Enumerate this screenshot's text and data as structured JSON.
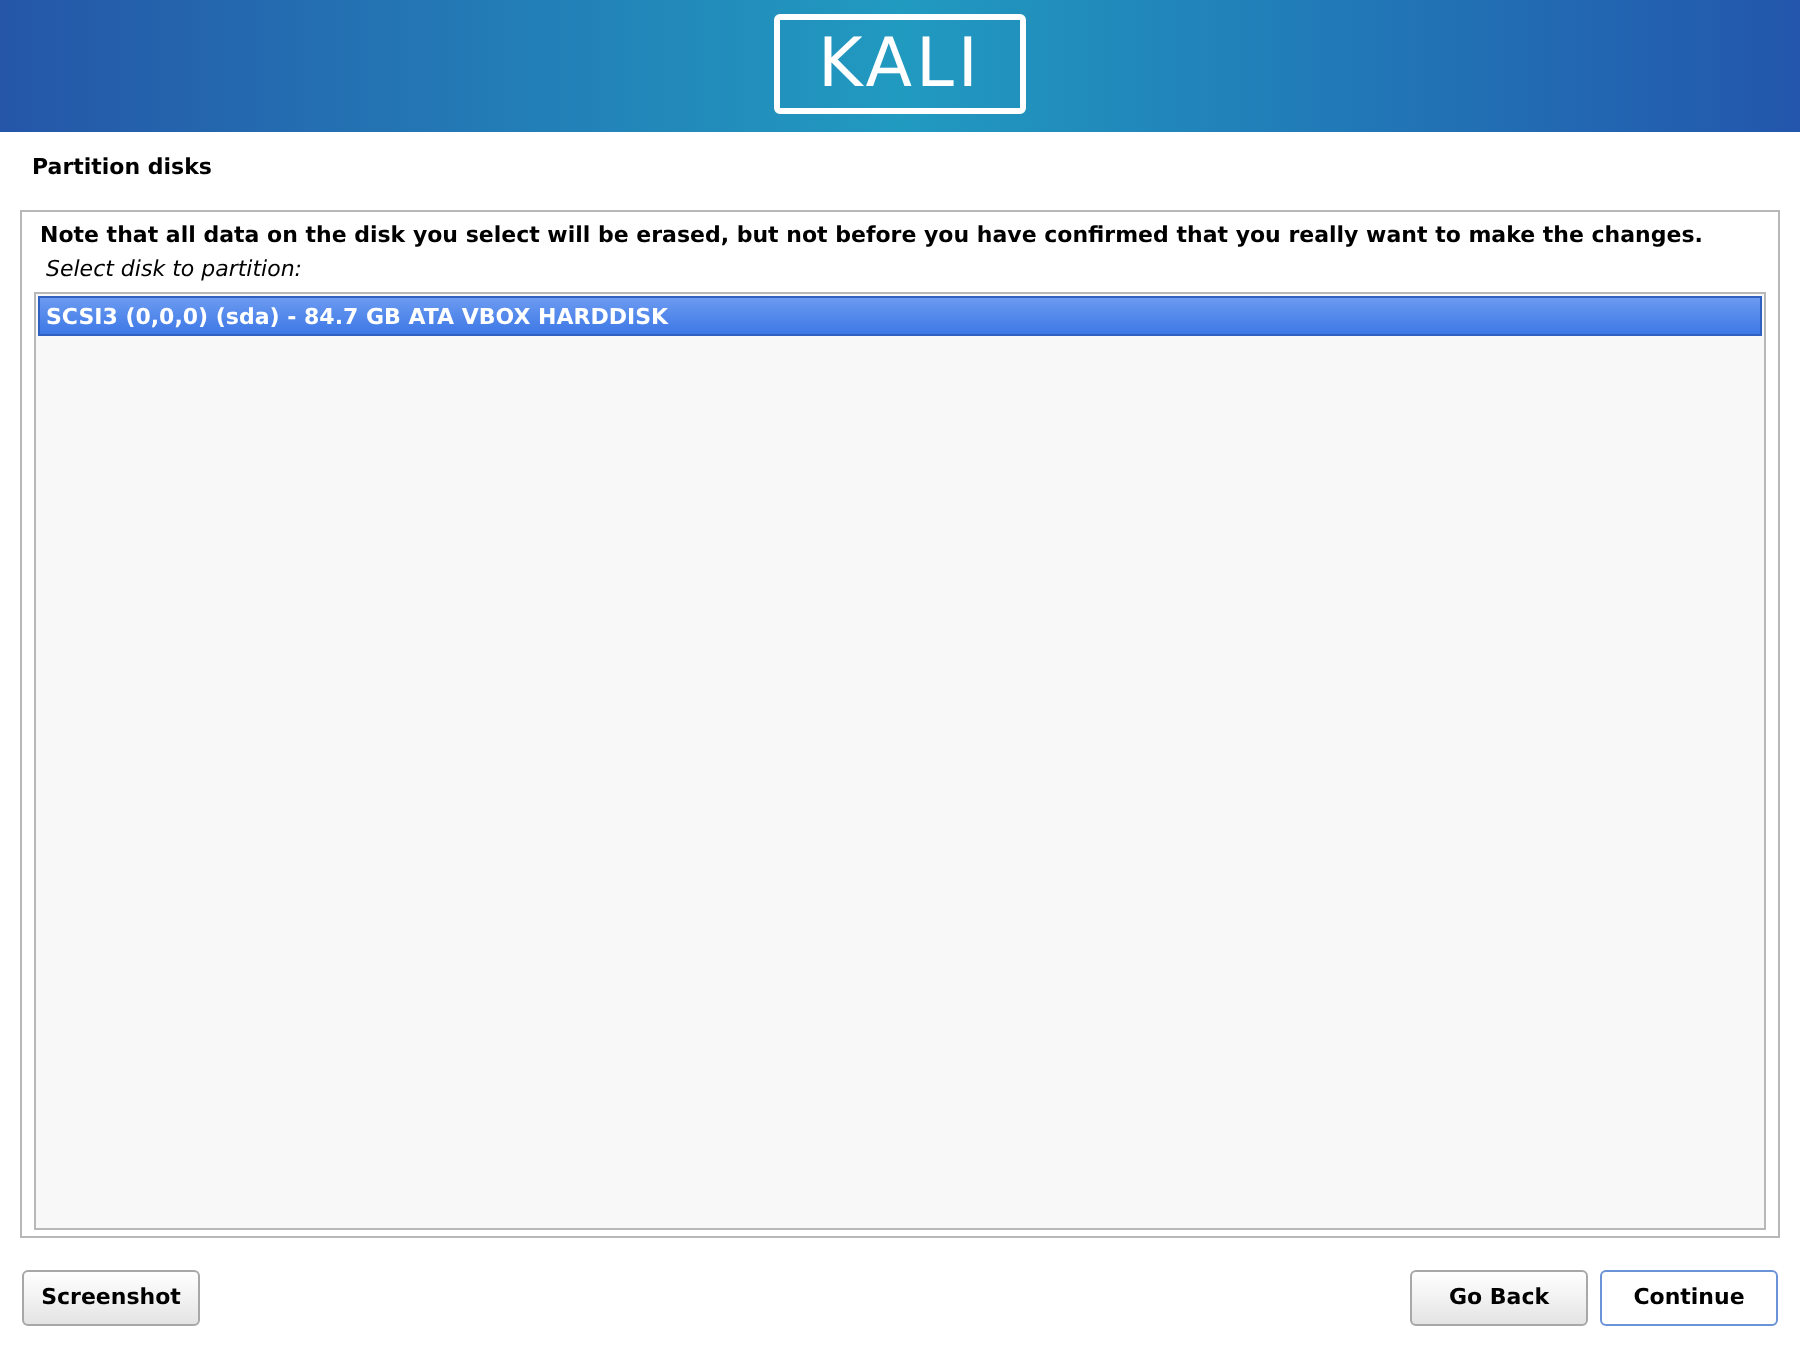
{
  "header": {
    "logo": "KALI"
  },
  "page_title": "Partition disks",
  "notice": "Note that all data on the disk you select will be erased, but not before you have confirmed that you really want to make the changes.",
  "prompt": "Select disk to partition:",
  "disks": [
    {
      "label": "SCSI3 (0,0,0) (sda) - 84.7 GB ATA VBOX HARDDISK",
      "selected": true
    }
  ],
  "buttons": [
    {
      "label": "Screenshot",
      "focused": false
    },
    {
      "label": "Go Back",
      "focused": false
    },
    {
      "label": "Continue",
      "focused": true
    }
  ]
}
